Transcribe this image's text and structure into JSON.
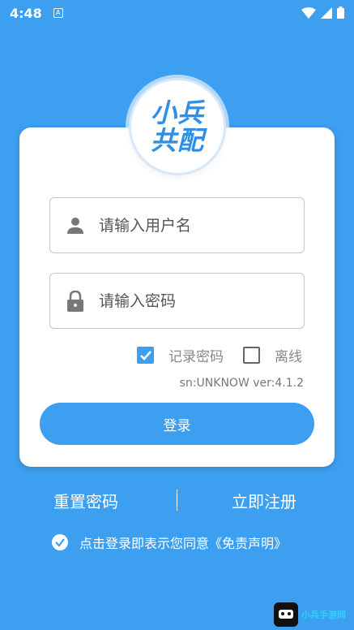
{
  "status": {
    "time": "4:48",
    "a_icon": "A"
  },
  "logo": {
    "line1": "小兵",
    "line2": "共配"
  },
  "form": {
    "username_placeholder": "请输入用户名",
    "password_placeholder": "请输入密码",
    "remember_label": "记录密码",
    "remember_checked": true,
    "offline_label": "离线",
    "offline_checked": false,
    "version": "sn:UNKNOW ver:4.1.2",
    "login_label": "登录"
  },
  "links": {
    "reset_password": "重置密码",
    "register": "立即注册"
  },
  "agreement": {
    "text": "点击登录即表示您同意《免责声明》"
  },
  "watermark": {
    "text": "小兵手游网"
  },
  "colors": {
    "primary": "#3d9ff0",
    "card": "#ffffff"
  }
}
